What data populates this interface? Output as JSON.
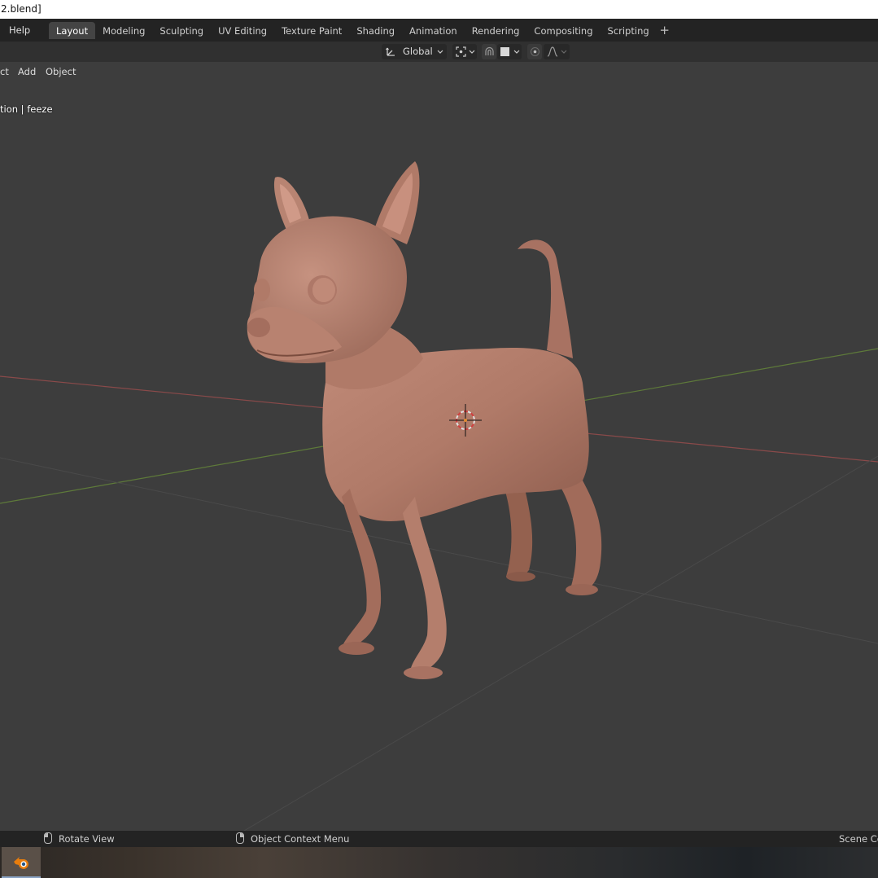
{
  "window": {
    "title": "2.blend]"
  },
  "topbar": {
    "menu_help": "Help",
    "tabs": [
      "Layout",
      "Modeling",
      "Sculpting",
      "UV Editing",
      "Texture Paint",
      "Shading",
      "Animation",
      "Rendering",
      "Compositing",
      "Scripting"
    ],
    "active_tab": "Layout",
    "add_tab_icon": "plus-icon"
  },
  "viewport_header": {
    "orientation_label": "Global",
    "icons": [
      "transform-orientation-icon",
      "chevron-down-icon",
      "pivot-point-icon",
      "snap-icon",
      "snap-target-icon",
      "proportional-edit-icon",
      "falloff-icon"
    ]
  },
  "sub_header": {
    "partial_menu": "ct",
    "add_menu": "Add",
    "object_menu": "Object"
  },
  "viewport": {
    "overlay_text": "tion | feeze",
    "model_color": "#b07a68",
    "background": "#3d3d3d"
  },
  "statusbar": {
    "rotate_view": "Rotate View",
    "context_menu": "Object Context Menu",
    "scene_collection": "Scene Col"
  },
  "taskbar": {
    "app_icon": "blender-icon"
  }
}
